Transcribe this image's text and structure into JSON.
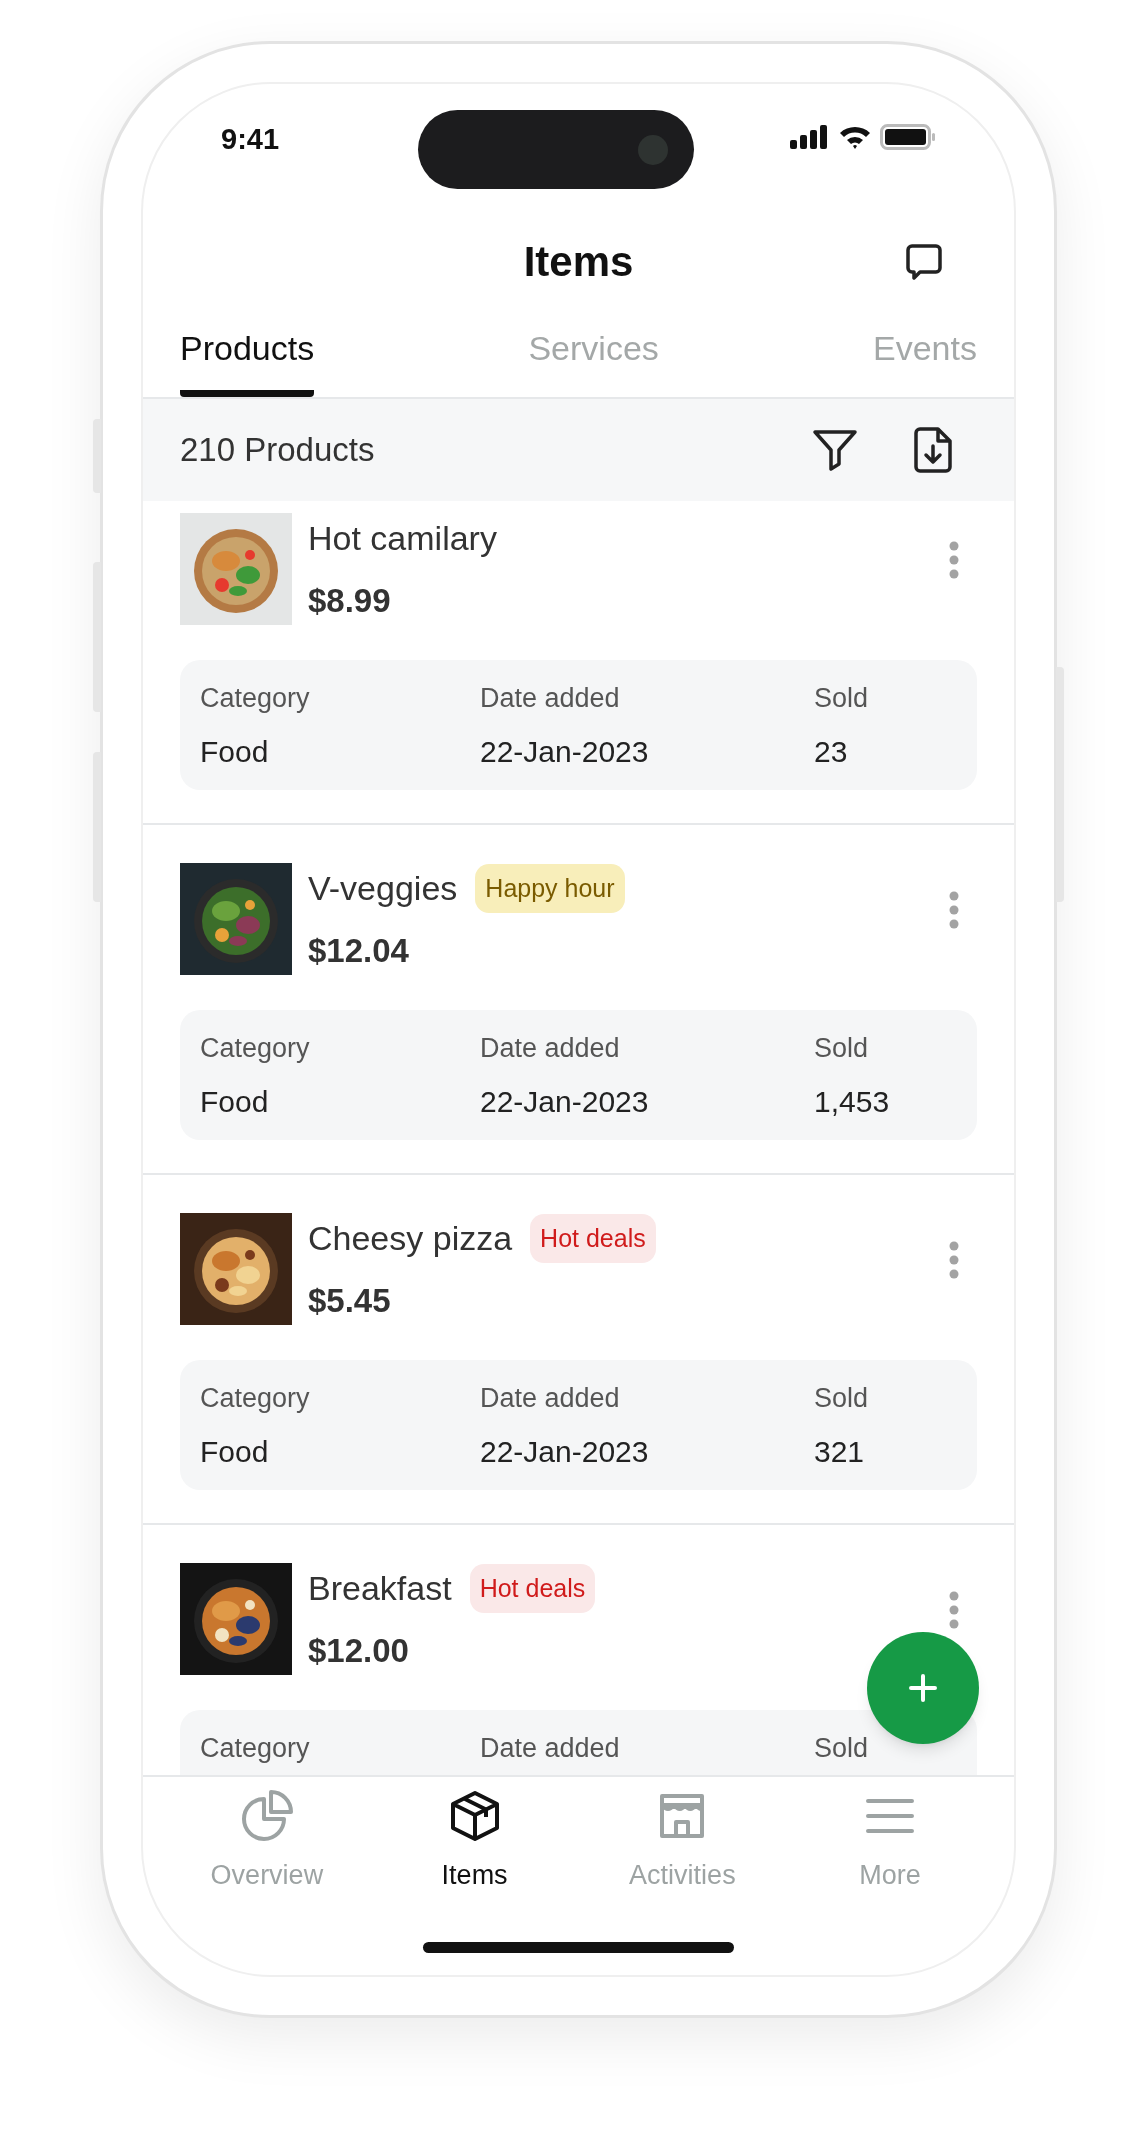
{
  "status_bar": {
    "time": "9:41"
  },
  "header": {
    "title": "Items"
  },
  "tabs": [
    {
      "label": "Products",
      "selected": true
    },
    {
      "label": "Services",
      "selected": false
    },
    {
      "label": "Events",
      "selected": false
    }
  ],
  "list_header": {
    "count": "210 Products"
  },
  "products": [
    {
      "name": "Hot camilary",
      "price": "$8.99",
      "details": [
        {
          "label": "Category",
          "value": "Food"
        },
        {
          "label": "Date added",
          "value": "22-Jan-2023"
        },
        {
          "label": "Sold",
          "value": "23"
        }
      ]
    },
    {
      "name": "V-veggies",
      "price": "$12.04",
      "tag": {
        "text": "Happy hour",
        "color": "#7a5b00"
      },
      "details": [
        {
          "label": "Category",
          "value": "Food"
        },
        {
          "label": "Date added",
          "value": "22-Jan-2023"
        },
        {
          "label": "Sold",
          "value": "1,453"
        }
      ]
    },
    {
      "name": "Cheesy pizza",
      "price": "$5.45",
      "tag": {
        "text": "Hot deals",
        "color": "#d01b1b"
      },
      "details": [
        {
          "label": "Category",
          "value": "Food"
        },
        {
          "label": "Date added",
          "value": "22-Jan-2023"
        },
        {
          "label": "Sold",
          "value": "321"
        }
      ]
    },
    {
      "name": "Breakfast",
      "price": "$12.00",
      "tag": {
        "text": "Hot deals",
        "color": "#d01b1b"
      },
      "details": [
        {
          "label": "Category"
        },
        {
          "label": "Date added"
        },
        {
          "label": "Sold"
        }
      ]
    }
  ],
  "nav": [
    {
      "label": "Overview",
      "selected": false
    },
    {
      "label": "Items",
      "selected": true
    },
    {
      "label": "Activities",
      "selected": false
    },
    {
      "label": "More",
      "selected": false
    }
  ]
}
